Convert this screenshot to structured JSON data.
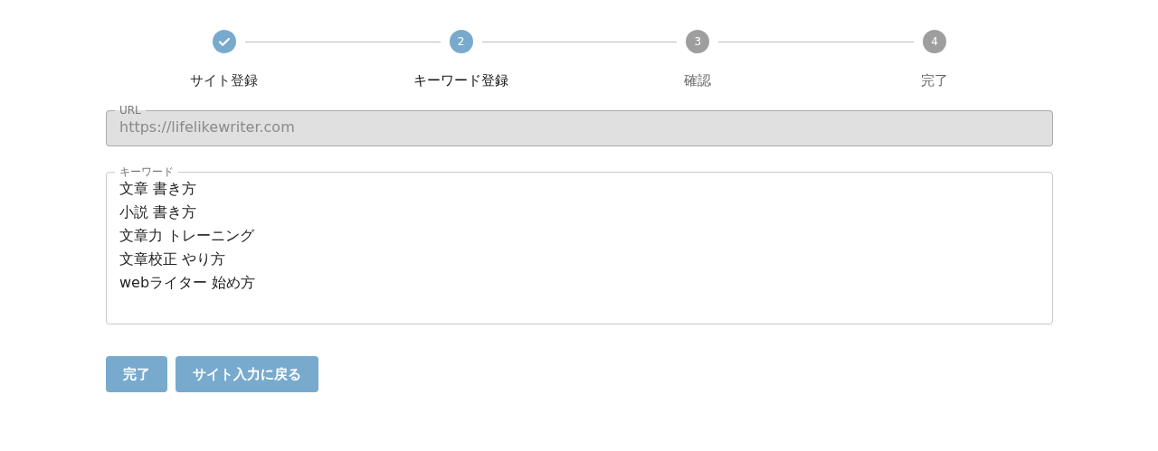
{
  "steps": [
    {
      "label": "サイト登録",
      "done": true,
      "selected": false
    },
    {
      "number": "2",
      "label": "キーワード登録",
      "done": false,
      "selected": true
    },
    {
      "number": "3",
      "label": "確認",
      "done": false,
      "selected": false
    },
    {
      "number": "4",
      "label": "完了",
      "done": false,
      "selected": false
    }
  ],
  "url_field": {
    "label": "URL",
    "value": "https://lifelikewriter.com",
    "disabled": true
  },
  "keyword_field": {
    "label": "キーワード",
    "lines": [
      "文章 書き方",
      "小説 書き方",
      "文章力 トレーニング",
      "文章校正 やり方",
      "webライター 始め方"
    ]
  },
  "buttons": [
    {
      "label": "完了"
    },
    {
      "label": "サイト入力に戻る"
    }
  ]
}
